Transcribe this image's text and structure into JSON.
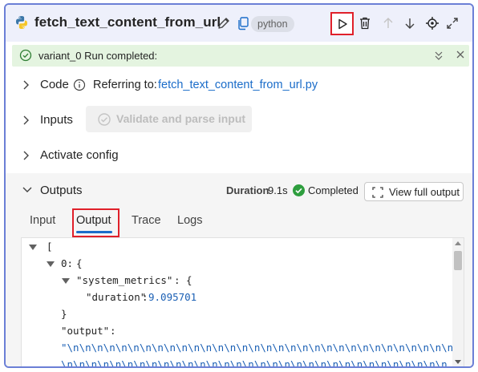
{
  "node": {
    "title": "fetch_text_content_from_url",
    "language": "python",
    "icons": [
      "python-icon",
      "edit-icon",
      "copy-icon",
      "run-icon",
      "delete-icon",
      "move-up-icon",
      "move-down-icon",
      "locate-icon",
      "expand-icon"
    ]
  },
  "status": {
    "text": "variant_0 Run completed:",
    "color": "#e4f4e0"
  },
  "code": {
    "label": "Code",
    "referring_to": "Referring to:",
    "file_link": "fetch_text_content_from_url.py"
  },
  "inputs": {
    "label": "Inputs",
    "validate_button": "Validate and parse input"
  },
  "activate": {
    "label": "Activate config"
  },
  "outputs": {
    "label": "Outputs",
    "duration_label": "Duration",
    "duration_value": "9.1s",
    "completed": "Completed",
    "view_full_button": "View full output",
    "tabs": [
      "Input",
      "Output",
      "Trace",
      "Logs"
    ],
    "active_tab": "Output"
  },
  "json_view": {
    "lines": [
      "[",
      "0:",
      "{",
      "\"system_metrics\"",
      ":",
      "{",
      "\"duration\"",
      "9.095701",
      "}",
      "\"output\"",
      "\"\\n\\n\\n\\n\\n\\n\\n\\n\\n\\n\\n\\n\\n\\n\\n\\n\\n\\n\\n\\n\\n\\n\\n\\n\\n\\n\\n\\n\\n\\n\\n\\n",
      "\\n\\n\\n\\n\\n\\n\\n\\n\\n\\n\\n\\n\\n\\n\\n\\n\\n\\n\\n\\n\\n\\n\\n\\n\\n\\n\\n\\n\\n\\n\\n\\n"
    ]
  },
  "colors": {
    "accent": "#1a6cc9",
    "border": "#6b7fd6",
    "highlight": "#e0202a",
    "success": "#2e9e3e"
  }
}
